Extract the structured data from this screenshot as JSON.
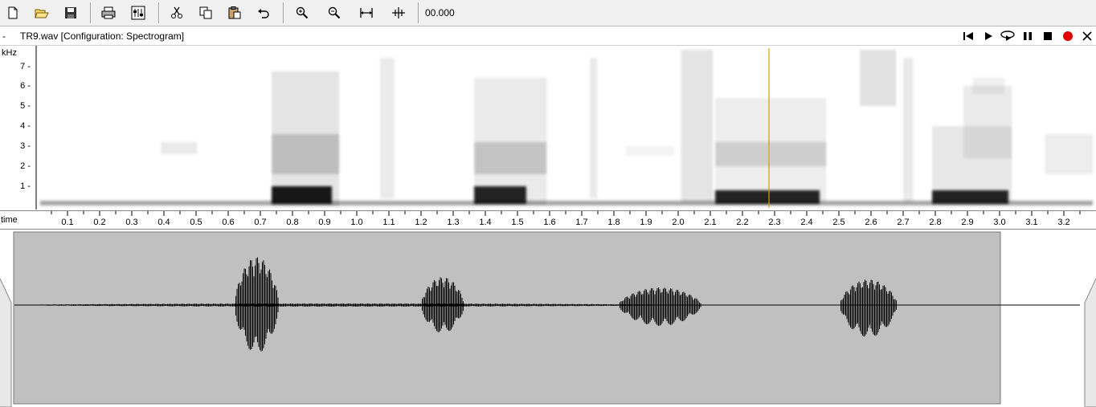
{
  "toolbar": {
    "buttons": [
      {
        "name": "new-file-icon"
      },
      {
        "name": "open-folder-icon"
      },
      {
        "name": "save-icon"
      },
      {
        "name": "print-icon"
      },
      {
        "name": "settings-icon"
      },
      {
        "name": "cut-icon"
      },
      {
        "name": "copy-icon"
      },
      {
        "name": "paste-icon"
      },
      {
        "name": "undo-icon"
      },
      {
        "name": "zoom-in-icon"
      },
      {
        "name": "zoom-out-icon"
      },
      {
        "name": "zoom-fit-icon"
      },
      {
        "name": "zoom-selection-icon"
      }
    ],
    "time_readout": "00.000"
  },
  "titlebar": {
    "dash": "-",
    "title": "TR9.wav  [Configuration: Spectrogram]",
    "controls": [
      "skip-to-start-icon",
      "play-icon",
      "loop-play-icon",
      "pause-icon",
      "stop-icon",
      "record-icon",
      "close-icon"
    ],
    "record_color": "#e00000"
  },
  "spectrogram": {
    "y_unit": "kHz",
    "y_ticks": [
      "7",
      "6",
      "5",
      "4",
      "3",
      "2",
      "1"
    ],
    "cursor_time": 2.28,
    "cursor_color": "#d8a000"
  },
  "timeline": {
    "label": "time",
    "ticks": [
      "0.1",
      "0.2",
      "0.3",
      "0.4",
      "0.5",
      "0.6",
      "0.7",
      "0.8",
      "0.9",
      "1.0",
      "1.1",
      "1.2",
      "1.3",
      "1.4",
      "1.5",
      "1.6",
      "1.7",
      "1.8",
      "1.9",
      "2.0",
      "2.1",
      "2.2",
      "2.3",
      "2.4",
      "2.5",
      "2.6",
      "2.7",
      "2.8",
      "2.9",
      "3.0",
      "3.1",
      "3.2",
      "3"
    ]
  },
  "waveform": {
    "view_bg": "#c0c0c0",
    "selected_fraction_start": 0.0,
    "selected_fraction_end": 0.925
  }
}
